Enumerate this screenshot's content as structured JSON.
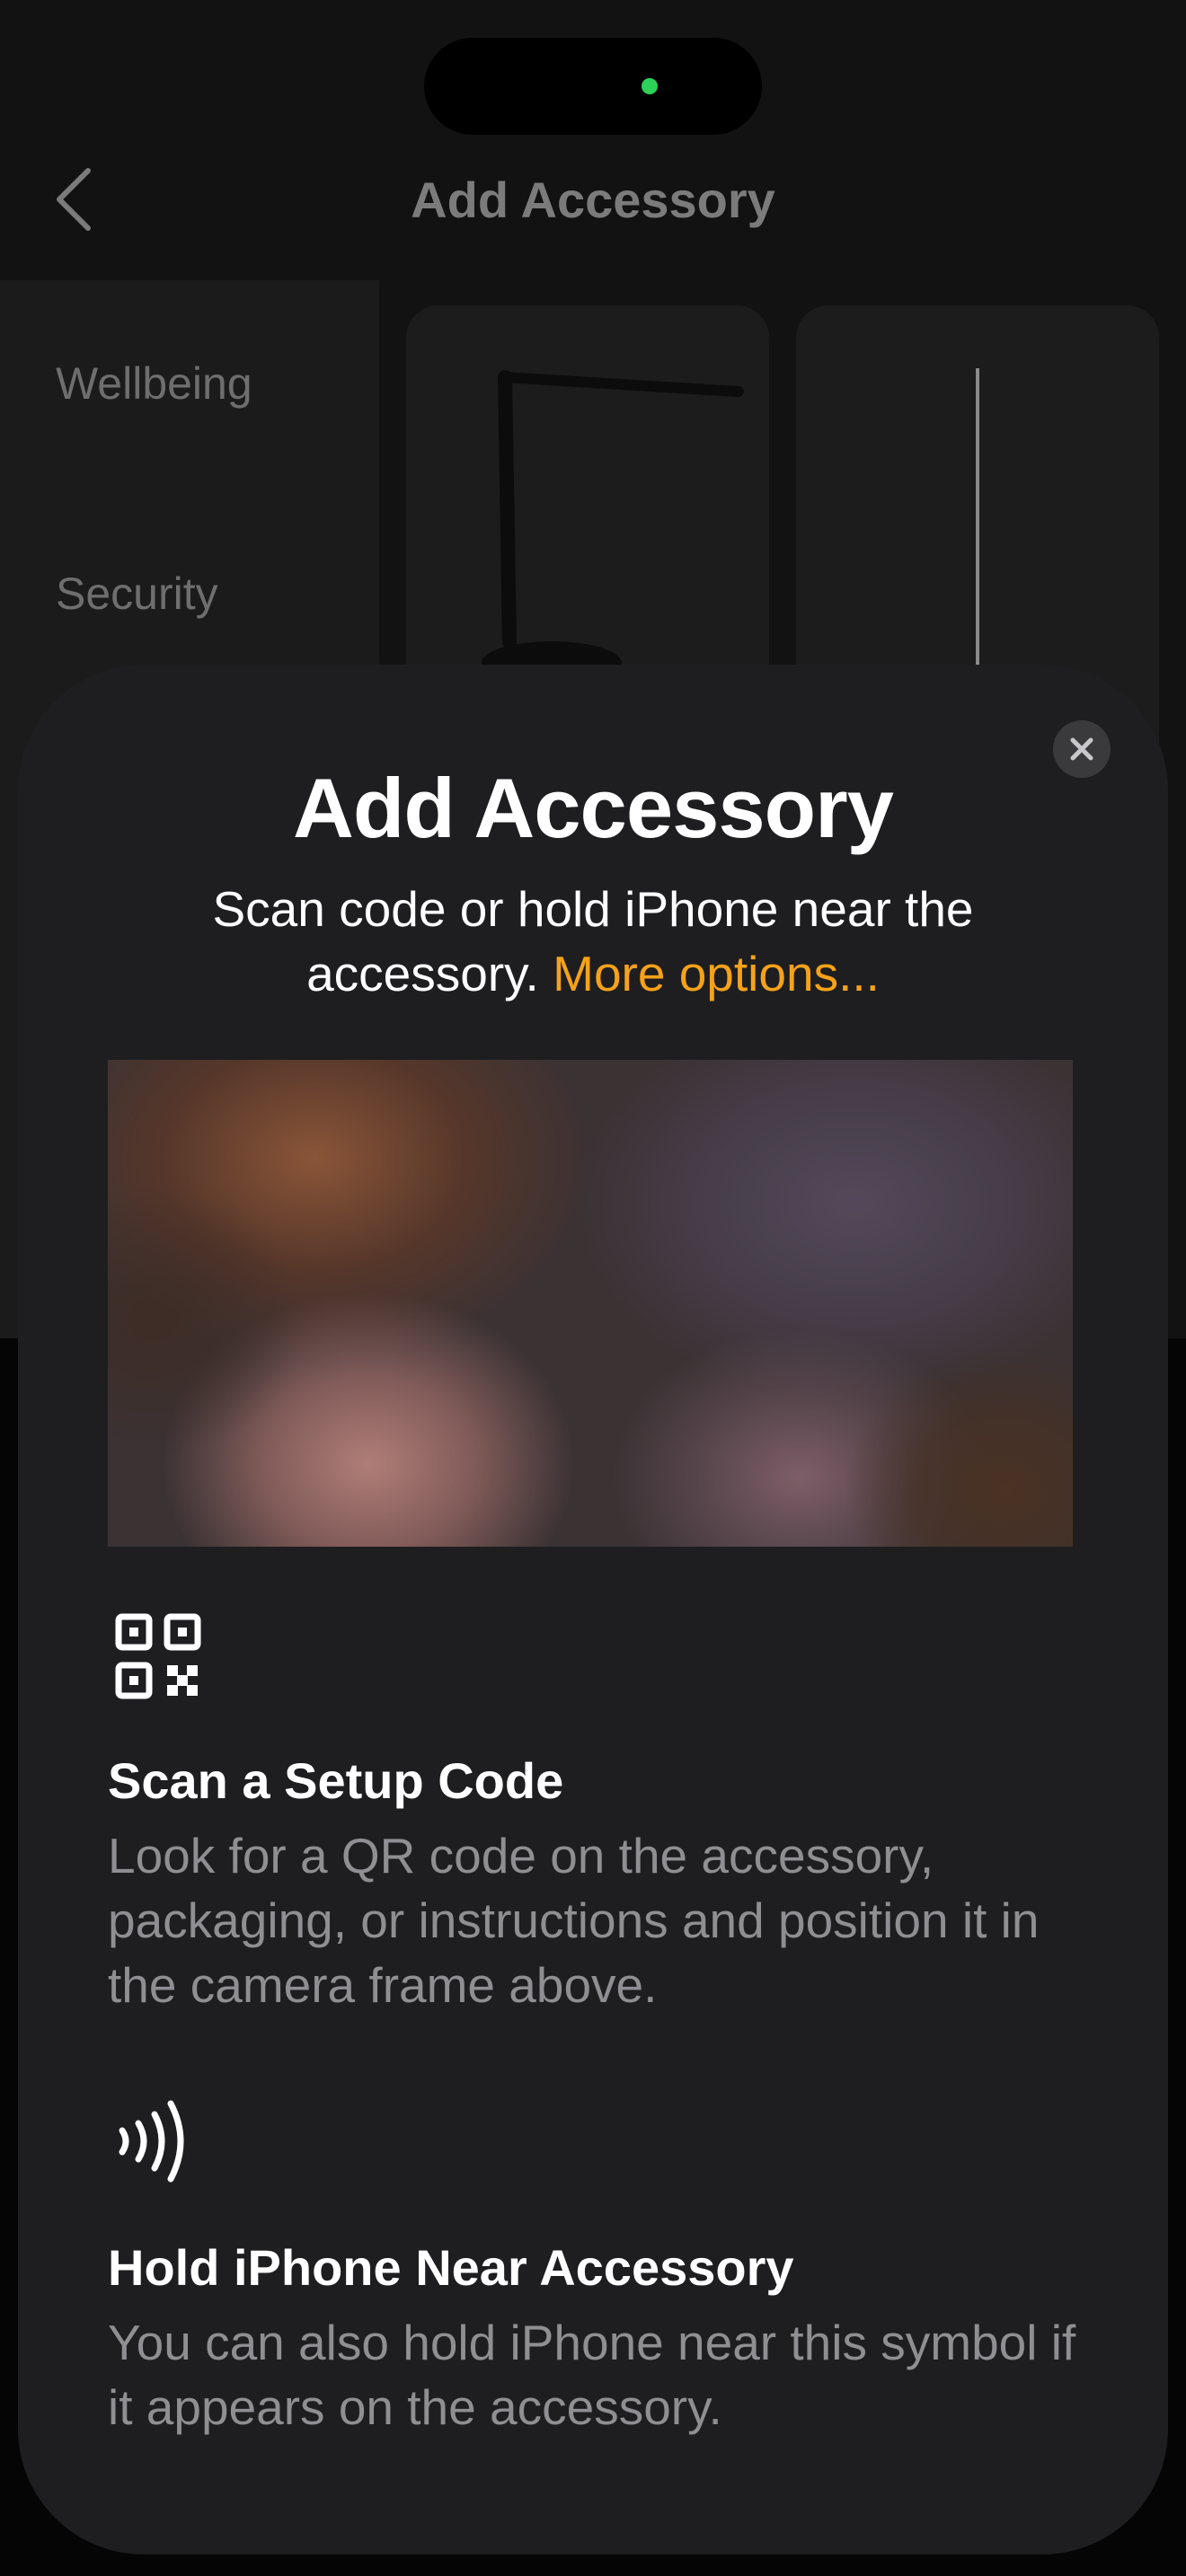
{
  "nav": {
    "title": "Add Accessory"
  },
  "sidebar": {
    "items": [
      {
        "label": "Wellbeing"
      },
      {
        "label": "Security"
      }
    ]
  },
  "sheet": {
    "title": "Add Accessory",
    "subtitle": "Scan code or hold iPhone near the accessory.",
    "more_options_label": "More options...",
    "accent_color": "#f5a21a",
    "sections": [
      {
        "icon": "qr-code-icon",
        "title": "Scan a Setup Code",
        "body": "Look for a QR code on the accessory, packaging, or instructions and position it in the camera frame above."
      },
      {
        "icon": "nfc-waves-icon",
        "title": "Hold iPhone Near Accessory",
        "body": "You can also hold iPhone near this symbol if it appears on the accessory."
      }
    ]
  }
}
